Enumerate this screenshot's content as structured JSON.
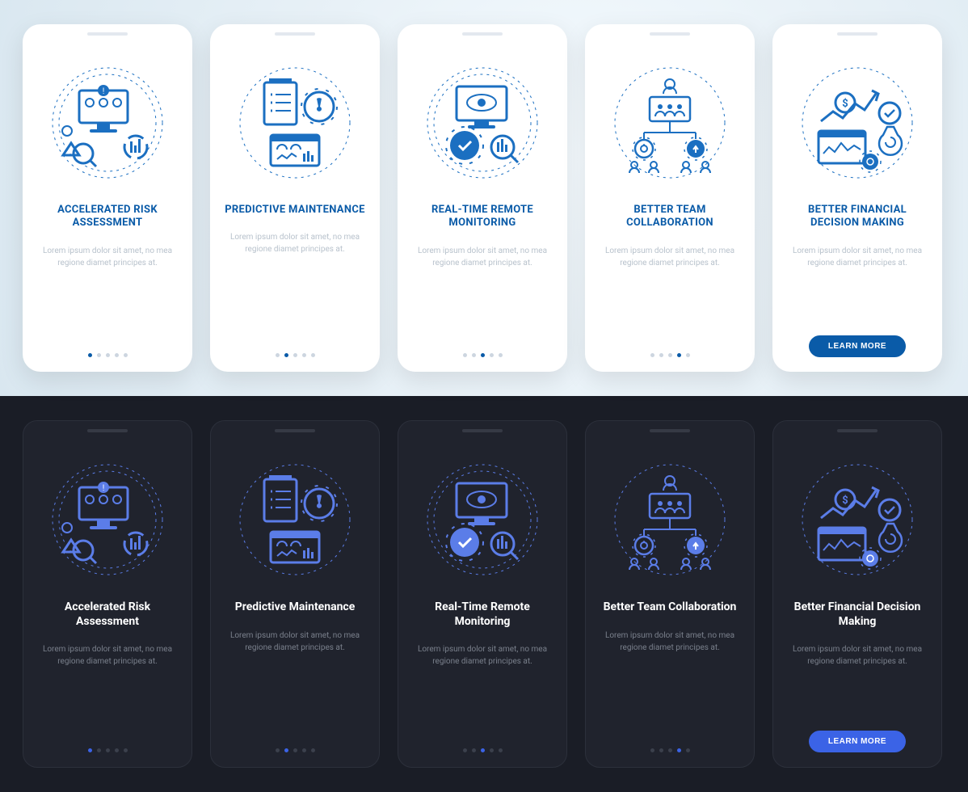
{
  "common": {
    "body_text": "Lorem ipsum dolor sit amet, no mea regione diamet principes at.",
    "cta_label": "LEARN MORE"
  },
  "light": {
    "cards": [
      {
        "title": "ACCELERATED RISK ASSESSMENT",
        "active": 0,
        "icon": "risk"
      },
      {
        "title": "PREDICTIVE MAINTENANCE",
        "active": 1,
        "icon": "maintenance"
      },
      {
        "title": "REAL-TIME REMOTE MONITORING",
        "active": 2,
        "icon": "monitoring"
      },
      {
        "title": "BETTER TEAM COLLABORATION",
        "active": 3,
        "icon": "collaboration"
      },
      {
        "title": "BETTER FINANCIAL DECISION MAKING",
        "active": -1,
        "icon": "financial",
        "cta": true
      }
    ]
  },
  "dark": {
    "cards": [
      {
        "title": "Accelerated Risk Assessment",
        "active": 0,
        "icon": "risk"
      },
      {
        "title": "Predictive Maintenance",
        "active": 1,
        "icon": "maintenance"
      },
      {
        "title": "Real-Time Remote Monitoring",
        "active": 2,
        "icon": "monitoring"
      },
      {
        "title": "Better Team Collaboration",
        "active": 3,
        "icon": "collaboration"
      },
      {
        "title": "Better Financial Decision Making",
        "active": -1,
        "icon": "financial",
        "cta": true
      }
    ]
  }
}
